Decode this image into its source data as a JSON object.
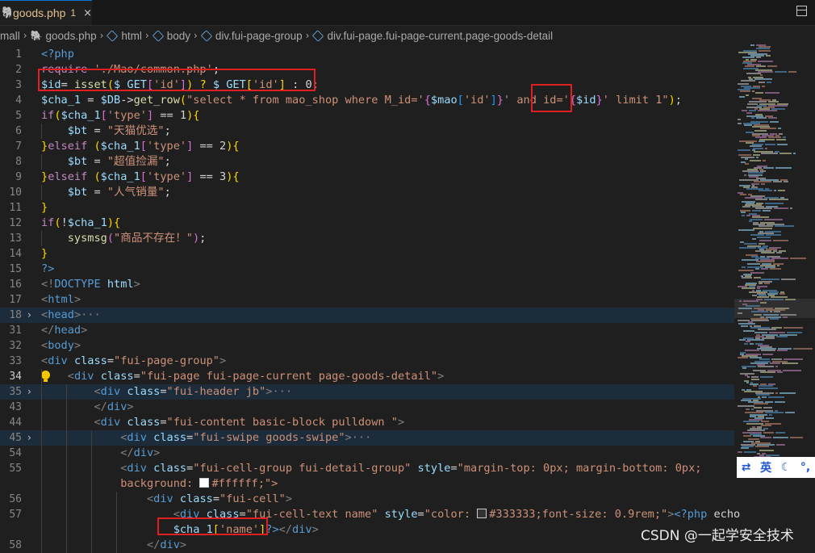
{
  "tab": {
    "icon": "php-elephant-icon",
    "label": "goods.php",
    "modified_count": "1",
    "close": "×"
  },
  "breadcrumb": [
    "mall",
    "goods.php",
    "html",
    "body",
    "div.fui-page-group",
    "div.fui-page.fui-page-current.page-goods-detail"
  ],
  "lines": [
    {
      "n": "1",
      "segs": [
        [
          "<?php",
          "t-tag"
        ]
      ]
    },
    {
      "n": "2",
      "segs": [
        [
          "require ",
          "t-kw"
        ],
        [
          "'./Mao/common.php'",
          "t-str"
        ],
        [
          ";",
          "t-txt"
        ]
      ]
    },
    {
      "n": "3",
      "segs": [
        [
          "$id",
          "t-var"
        ],
        [
          "= ",
          "t-txt"
        ],
        [
          "isset",
          "t-fn"
        ],
        [
          "(",
          "t-br"
        ],
        [
          "$_GET",
          "t-var"
        ],
        [
          "[",
          "t-br2"
        ],
        [
          "'id'",
          "t-str"
        ],
        [
          "]",
          "t-br2"
        ],
        [
          ") ? ",
          "t-br"
        ],
        [
          "$_GET",
          "t-var"
        ],
        [
          "[",
          "t-br"
        ],
        [
          "'id'",
          "t-str"
        ],
        [
          "]",
          "t-br"
        ],
        [
          " : ",
          "t-txt"
        ],
        [
          "0",
          "t-txt"
        ],
        [
          ";",
          "t-txt"
        ]
      ]
    },
    {
      "n": "4",
      "segs": [
        [
          "$cha_1",
          "t-var"
        ],
        [
          " = ",
          "t-txt"
        ],
        [
          "$DB",
          "t-var"
        ],
        [
          "->",
          "t-txt"
        ],
        [
          "get_row",
          "t-fn"
        ],
        [
          "(",
          "t-br"
        ],
        [
          "\"select * from mao_shop where M_id='",
          "t-str"
        ],
        [
          "{",
          "t-br2"
        ],
        [
          "$mao",
          "t-var"
        ],
        [
          "[",
          "t-br3"
        ],
        [
          "'id'",
          "t-str"
        ],
        [
          "]",
          "t-br3"
        ],
        [
          "}",
          "t-br2"
        ],
        [
          "' and id='",
          "t-str"
        ],
        [
          "{",
          "t-br2"
        ],
        [
          "$id",
          "t-var"
        ],
        [
          "}",
          "t-br2"
        ],
        [
          "' limit 1\"",
          "t-str"
        ],
        [
          ")",
          "t-br"
        ],
        [
          ";",
          "t-txt"
        ]
      ]
    },
    {
      "n": "5",
      "segs": [
        [
          "if",
          "t-kw"
        ],
        [
          "(",
          "t-br"
        ],
        [
          "$cha_1",
          "t-var"
        ],
        [
          "[",
          "t-br2"
        ],
        [
          "'type'",
          "t-str"
        ],
        [
          "]",
          "t-br2"
        ],
        [
          " == 1",
          "t-txt"
        ],
        [
          ")",
          "t-br"
        ],
        [
          "{",
          "t-br"
        ]
      ]
    },
    {
      "n": "6",
      "segs": [
        [
          "    ",
          "t-txt"
        ],
        [
          "$bt",
          "t-var"
        ],
        [
          " = ",
          "t-txt"
        ],
        [
          "\"天猫优选\"",
          "t-str"
        ],
        [
          ";",
          "t-txt"
        ]
      ]
    },
    {
      "n": "7",
      "segs": [
        [
          "}",
          "t-br"
        ],
        [
          "elseif ",
          "t-kw"
        ],
        [
          "(",
          "t-br"
        ],
        [
          "$cha_1",
          "t-var"
        ],
        [
          "[",
          "t-br2"
        ],
        [
          "'type'",
          "t-str"
        ],
        [
          "]",
          "t-br2"
        ],
        [
          " == 2",
          "t-txt"
        ],
        [
          ")",
          "t-br"
        ],
        [
          "{",
          "t-br"
        ]
      ]
    },
    {
      "n": "8",
      "segs": [
        [
          "    ",
          "t-txt"
        ],
        [
          "$bt",
          "t-var"
        ],
        [
          " = ",
          "t-txt"
        ],
        [
          "\"超值捡漏\"",
          "t-str"
        ],
        [
          ";",
          "t-txt"
        ]
      ]
    },
    {
      "n": "9",
      "segs": [
        [
          "}",
          "t-br"
        ],
        [
          "elseif ",
          "t-kw"
        ],
        [
          "(",
          "t-br"
        ],
        [
          "$cha_1",
          "t-var"
        ],
        [
          "[",
          "t-br2"
        ],
        [
          "'type'",
          "t-str"
        ],
        [
          "]",
          "t-br2"
        ],
        [
          " == 3",
          "t-txt"
        ],
        [
          ")",
          "t-br"
        ],
        [
          "{",
          "t-br"
        ]
      ]
    },
    {
      "n": "10",
      "segs": [
        [
          "    ",
          "t-txt"
        ],
        [
          "$bt",
          "t-var"
        ],
        [
          " = ",
          "t-txt"
        ],
        [
          "\"人气销量\"",
          "t-str"
        ],
        [
          ";",
          "t-txt"
        ]
      ]
    },
    {
      "n": "11",
      "segs": [
        [
          "}",
          "t-br"
        ]
      ]
    },
    {
      "n": "12",
      "segs": [
        [
          "if",
          "t-kw"
        ],
        [
          "(",
          "t-br"
        ],
        [
          "!",
          "t-txt"
        ],
        [
          "$cha_1",
          "t-var"
        ],
        [
          ")",
          "t-br"
        ],
        [
          "{",
          "t-br"
        ]
      ]
    },
    {
      "n": "13",
      "segs": [
        [
          "    ",
          "t-txt"
        ],
        [
          "sysmsg",
          "t-fn"
        ],
        [
          "(",
          "t-br2"
        ],
        [
          "\"商品不存在！\"",
          "t-str"
        ],
        [
          ")",
          "t-br2"
        ],
        [
          ";",
          "t-txt"
        ]
      ]
    },
    {
      "n": "14",
      "segs": [
        [
          "}",
          "t-br"
        ]
      ]
    },
    {
      "n": "15",
      "segs": [
        [
          "?>",
          "t-tag"
        ]
      ]
    },
    {
      "n": "16",
      "segs": [
        [
          "<!",
          "t-gr"
        ],
        [
          "DOCTYPE ",
          "t-tag"
        ],
        [
          "html",
          "t-attr"
        ],
        [
          ">",
          "t-gr"
        ]
      ]
    },
    {
      "n": "17",
      "segs": [
        [
          "<",
          "t-gr"
        ],
        [
          "html",
          "t-tag"
        ],
        [
          ">",
          "t-gr"
        ]
      ]
    },
    {
      "n": "18",
      "fold": "closed",
      "hl": true,
      "segs": [
        [
          "<",
          "t-gr"
        ],
        [
          "head",
          "t-tag"
        ],
        [
          ">",
          "t-gr"
        ],
        [
          "···",
          "t-dim"
        ]
      ]
    },
    {
      "n": "31",
      "segs": [
        [
          "</",
          "t-gr"
        ],
        [
          "head",
          "t-tag"
        ],
        [
          ">",
          "t-gr"
        ]
      ]
    },
    {
      "n": "32",
      "segs": [
        [
          "<",
          "t-gr"
        ],
        [
          "body",
          "t-tag"
        ],
        [
          ">",
          "t-gr"
        ]
      ]
    },
    {
      "n": "33",
      "segs": [
        [
          "<",
          "t-gr"
        ],
        [
          "div ",
          "t-tag"
        ],
        [
          "class",
          "t-attr"
        ],
        [
          "=",
          "t-txt"
        ],
        [
          "\"fui-page-group\"",
          "t-str"
        ],
        [
          ">",
          "t-gr"
        ]
      ]
    },
    {
      "n": "34",
      "cur": true,
      "bulb": true,
      "segs": [
        [
          "    ",
          "t-txt"
        ],
        [
          "<",
          "t-gr"
        ],
        [
          "div ",
          "t-tag"
        ],
        [
          "class",
          "t-attr"
        ],
        [
          "=",
          "t-txt"
        ],
        [
          "\"fui-page fui-page-current page-goods-detail\"",
          "t-str"
        ],
        [
          ">",
          "t-gr"
        ]
      ]
    },
    {
      "n": "35",
      "fold": "closed",
      "hl": true,
      "segs": [
        [
          "        ",
          "t-txt"
        ],
        [
          "<",
          "t-gr"
        ],
        [
          "div ",
          "t-tag"
        ],
        [
          "class",
          "t-attr"
        ],
        [
          "=",
          "t-txt"
        ],
        [
          "\"fui-header jb\"",
          "t-str"
        ],
        [
          ">",
          "t-gr"
        ],
        [
          "···",
          "t-dim"
        ]
      ]
    },
    {
      "n": "43",
      "segs": [
        [
          "        ",
          "t-txt"
        ],
        [
          "</",
          "t-gr"
        ],
        [
          "div",
          "t-tag"
        ],
        [
          ">",
          "t-gr"
        ]
      ]
    },
    {
      "n": "44",
      "segs": [
        [
          "        ",
          "t-txt"
        ],
        [
          "<",
          "t-gr"
        ],
        [
          "div ",
          "t-tag"
        ],
        [
          "class",
          "t-attr"
        ],
        [
          "=",
          "t-txt"
        ],
        [
          "\"fui-content basic-block pulldown \"",
          "t-str"
        ],
        [
          ">",
          "t-gr"
        ]
      ]
    },
    {
      "n": "45",
      "fold": "closed",
      "hl": true,
      "segs": [
        [
          "            ",
          "t-txt"
        ],
        [
          "<",
          "t-gr"
        ],
        [
          "div ",
          "t-tag"
        ],
        [
          "class",
          "t-attr"
        ],
        [
          "=",
          "t-txt"
        ],
        [
          "\"fui-swipe goods-swipe\"",
          "t-str"
        ],
        [
          ">",
          "t-gr"
        ],
        [
          "···",
          "t-dim"
        ]
      ]
    },
    {
      "n": "54",
      "segs": [
        [
          "            ",
          "t-txt"
        ],
        [
          "</",
          "t-gr"
        ],
        [
          "div",
          "t-tag"
        ],
        [
          ">",
          "t-gr"
        ]
      ]
    },
    {
      "n": "55",
      "segs": [
        [
          "            ",
          "t-txt"
        ],
        [
          "<",
          "t-gr"
        ],
        [
          "div ",
          "t-tag"
        ],
        [
          "class",
          "t-attr"
        ],
        [
          "=",
          "t-txt"
        ],
        [
          "\"fui-cell-group fui-detail-group\" ",
          "t-str"
        ],
        [
          "style",
          "t-attr"
        ],
        [
          "=",
          "t-txt"
        ],
        [
          "\"margin-top: 0px; margin-bottom: 0px;",
          "t-str"
        ]
      ]
    },
    {
      "n": "",
      "segs": [
        [
          "            ",
          "t-txt"
        ],
        [
          "background: ",
          "t-str"
        ],
        [
          "#ffffff",
          "t-str",
          "swatch-white"
        ],
        [
          ";\">",
          "t-str"
        ]
      ]
    },
    {
      "n": "56",
      "segs": [
        [
          "                ",
          "t-txt"
        ],
        [
          "<",
          "t-gr"
        ],
        [
          "div ",
          "t-tag"
        ],
        [
          "class",
          "t-attr"
        ],
        [
          "=",
          "t-txt"
        ],
        [
          "\"fui-cell\"",
          "t-str"
        ],
        [
          ">",
          "t-gr"
        ]
      ]
    },
    {
      "n": "57",
      "segs": [
        [
          "                    ",
          "t-txt"
        ],
        [
          "<",
          "t-gr"
        ],
        [
          "div ",
          "t-tag"
        ],
        [
          "class",
          "t-attr"
        ],
        [
          "=",
          "t-txt"
        ],
        [
          "\"fui-cell-text name\" ",
          "t-str"
        ],
        [
          "style",
          "t-attr"
        ],
        [
          "=",
          "t-txt"
        ],
        [
          "\"color: ",
          "t-str"
        ],
        [
          "#333333",
          "t-str",
          "swatch-dark"
        ],
        [
          ";font-size: 0.9rem;\"",
          "t-str"
        ],
        [
          ">",
          "t-gr"
        ],
        [
          "<?php ",
          "t-tag"
        ],
        [
          "echo",
          "t-txt"
        ]
      ]
    },
    {
      "n": "",
      "segs": [
        [
          "                    ",
          "t-txt"
        ],
        [
          "$cha_1",
          "t-var"
        ],
        [
          "[",
          "t-br"
        ],
        [
          "'name'",
          "t-str"
        ],
        [
          "]",
          "t-br"
        ],
        [
          "?>",
          "t-tag"
        ],
        [
          "</",
          "t-gr"
        ],
        [
          "div",
          "t-tag"
        ],
        [
          ">",
          "t-gr"
        ]
      ]
    },
    {
      "n": "58",
      "segs": [
        [
          "                ",
          "t-txt"
        ],
        [
          "</",
          "t-gr"
        ],
        [
          "div",
          "t-tag"
        ],
        [
          ">",
          "t-gr"
        ]
      ]
    }
  ],
  "ime": {
    "icon": "ime-toggle-icon",
    "label": "英",
    "moon": "moon-icon",
    "punct": "punctuation-icon"
  },
  "watermark": "CSDN @一起学安全技术",
  "colors": {
    "background": "#1f1f1f",
    "highlight_box": "#e02020",
    "accent": "#0078d4"
  }
}
